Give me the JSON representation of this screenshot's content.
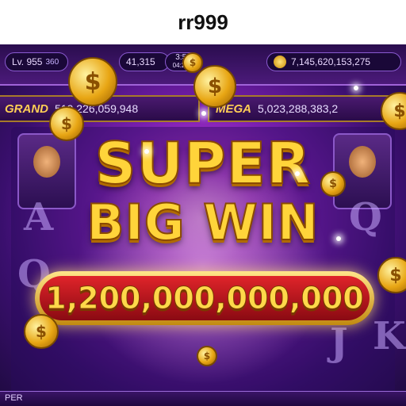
{
  "watermark": "rr999",
  "hud": {
    "level": "Lv. 955",
    "level_badge": "360",
    "bonus_value": "41,315",
    "timer_top": "3:59",
    "timer_sub": "04:29:3",
    "balance": "7,145,620,153,275"
  },
  "jackpots": [
    {
      "label": "GRAND",
      "value": "519,226,059,948"
    },
    {
      "label": "MEGA",
      "value": "5,023,288,383,2"
    }
  ],
  "win": {
    "line1": "SUPER",
    "line2": "BIG WIN",
    "amount": "1,200,000,000,000"
  },
  "reel_symbols": [
    "A",
    "Q",
    "Q",
    "K",
    "J"
  ],
  "bottom_label": "PER",
  "colors": {
    "gold": "#ffd43a",
    "banner_red": "#e0242a",
    "bg_purple": "#7a1fb0"
  }
}
